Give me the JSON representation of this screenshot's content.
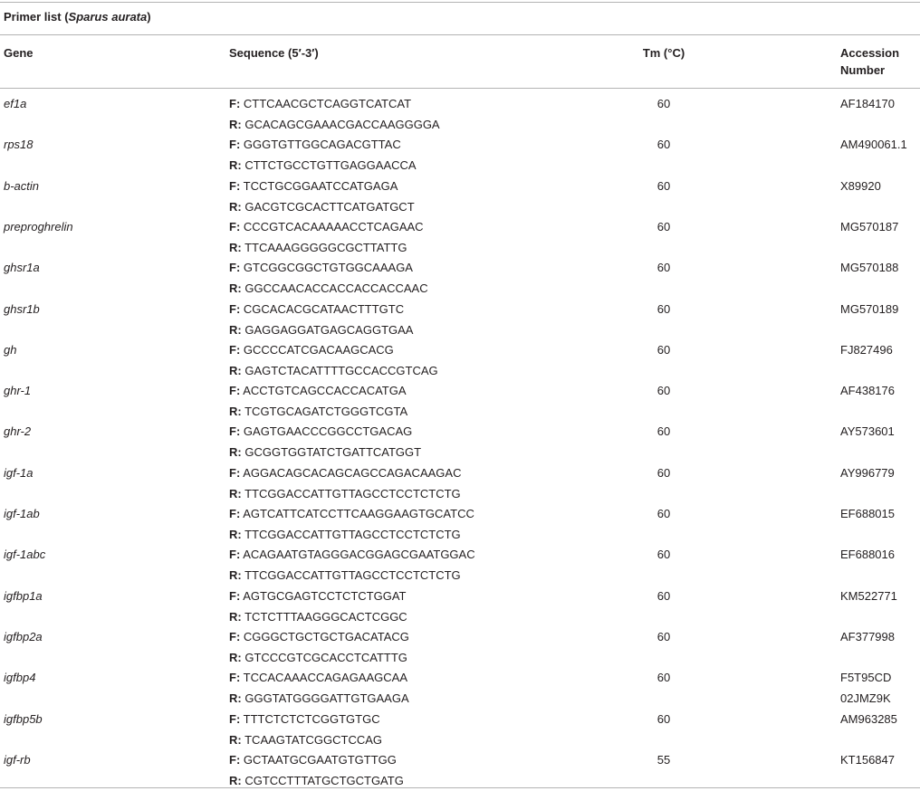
{
  "table": {
    "caption_prefix": "Primer list (",
    "caption_species": "Sparus aurata",
    "caption_suffix": ")",
    "headers": {
      "gene": "Gene",
      "sequence": "Sequence (5′-3′)",
      "tm": "Tm (°C)",
      "accession_line1": "Accession",
      "accession_line2": "Number"
    },
    "forward_prefix": "F:",
    "reverse_prefix": "R:",
    "rows": [
      {
        "gene": "ef1a",
        "forward": "CTTCAACGCTCAGGTCATCAT",
        "reverse": "GCACAGCGAAACGACCAAGGGGA",
        "tm": "60",
        "accession": "AF184170",
        "accession2": ""
      },
      {
        "gene": "rps18",
        "forward": "GGGTGTTGGCAGACGTTAC",
        "reverse": "CTTCTGCCTGTTGAGGAACCA",
        "tm": "60",
        "accession": "AM490061.1",
        "accession2": ""
      },
      {
        "gene": "b-actin",
        "forward": "TCCTGCGGAATCCATGAGA",
        "reverse": "GACGTCGCACTTCATGATGCT",
        "tm": "60",
        "accession": "X89920",
        "accession2": ""
      },
      {
        "gene": "preproghrelin",
        "forward": "CCCGTCACAAAAACCTCAGAAC",
        "reverse": "TTCAAAGGGGGCGCTTATTG",
        "tm": "60",
        "accession": "MG570187",
        "accession2": ""
      },
      {
        "gene": "ghsr1a",
        "forward": "GTCGGCGGCTGTGGCAAAGA",
        "reverse": "GGCCAACACCACCACCACCAAC",
        "tm": "60",
        "accession": "MG570188",
        "accession2": ""
      },
      {
        "gene": "ghsr1b",
        "forward": "CGCACACGCATAACTTTGTC",
        "reverse": "GAGGAGGATGAGCAGGTGAA",
        "tm": "60",
        "accession": "MG570189",
        "accession2": ""
      },
      {
        "gene": "gh",
        "forward": "GCCCCATCGACAAGCACG",
        "reverse": "GAGTCTACATTTTGCCACCGTCAG",
        "tm": "60",
        "accession": "FJ827496",
        "accession2": ""
      },
      {
        "gene": "ghr-1",
        "forward": "ACCTGTCAGCCACCACATGA",
        "reverse": "TCGTGCAGATCTGGGTCGTA",
        "tm": "60",
        "accession": "AF438176",
        "accession2": ""
      },
      {
        "gene": "ghr-2",
        "forward": "GAGTGAACCCGGCCTGACAG",
        "reverse": "GCGGTGGTATCTGATTCATGGT",
        "tm": "60",
        "accession": "AY573601",
        "accession2": ""
      },
      {
        "gene": "igf-1a",
        "forward": "AGGACAGCACAGCAGCCAGACAAGAC",
        "reverse": "TTCGGACCATTGTTAGCCTCCTCTCTG",
        "tm": "60",
        "accession": "AY996779",
        "accession2": ""
      },
      {
        "gene": "igf-1ab",
        "forward": "AGTCATTCATCCTTCAAGGAAGTGCATCC",
        "reverse": "TTCGGACCATTGTTAGCCTCCTCTCTG",
        "tm": "60",
        "accession": "EF688015",
        "accession2": ""
      },
      {
        "gene": "igf-1abc",
        "forward": "ACAGAATGTAGGGACGGAGCGAATGGAC",
        "reverse": "TTCGGACCATTGTTAGCCTCCTCTCTG",
        "tm": "60",
        "accession": "EF688016",
        "accession2": ""
      },
      {
        "gene": "igfbp1a",
        "forward": "AGTGCGAGTCCTCTCTGGAT",
        "reverse": "TCTCTTTAAGGGCACTCGGC",
        "tm": "60",
        "accession": "KM522771",
        "accession2": ""
      },
      {
        "gene": "igfbp2a",
        "forward": "CGGGCTGCTGCTGACATACG",
        "reverse": "GTCCCGTCGCACCTCATTTG",
        "tm": "60",
        "accession": "AF377998",
        "accession2": ""
      },
      {
        "gene": "igfbp4",
        "forward": "TCCACAAACCAGAGAAGCAA",
        "reverse": "GGGTATGGGGATTGTGAAGA",
        "tm": "60",
        "accession": "F5T95CD",
        "accession2": "02JMZ9K"
      },
      {
        "gene": "igfbp5b",
        "forward": "TTTCTCTCTCGGTGTGC",
        "reverse": "TCAAGTATCGGCTCCAG",
        "tm": "60",
        "accession": "AM963285",
        "accession2": ""
      },
      {
        "gene": "igf-rb",
        "forward": "GCTAATGCGAATGTGTTGG",
        "reverse": "CGTCCTTTATGCTGCTGATG",
        "tm": "55",
        "accession": "KT156847",
        "accession2": ""
      }
    ]
  }
}
